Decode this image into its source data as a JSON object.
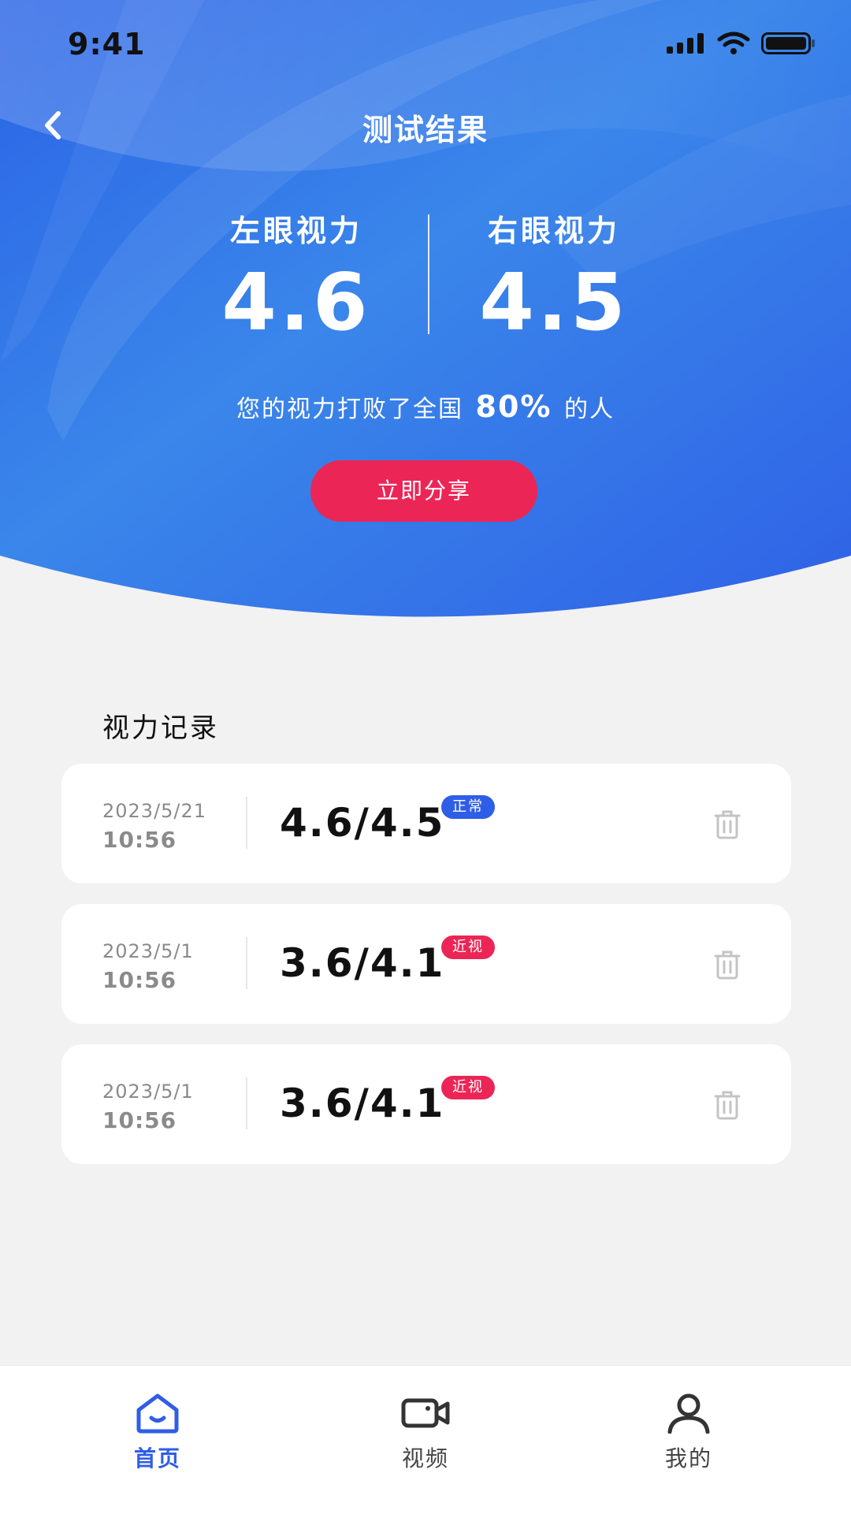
{
  "status_bar": {
    "time": "9:41"
  },
  "nav": {
    "title": "测试结果"
  },
  "result": {
    "left_label": "左眼视力",
    "left_value": "4.6",
    "right_label": "右眼视力",
    "right_value": "4.5",
    "beat_prefix": "您的视力打败了全国",
    "beat_percent": "80%",
    "beat_suffix": "的人",
    "share_label": "立即分享"
  },
  "records": {
    "title": "视力记录",
    "items": [
      {
        "date": "2023/5/21",
        "time": "10:56",
        "score": "4.6/4.5",
        "badge": "正常",
        "badge_color": "#2f5ee6"
      },
      {
        "date": "2023/5/1",
        "time": "10:56",
        "score": "3.6/4.1",
        "badge": "近视",
        "badge_color": "#eb2656"
      },
      {
        "date": "2023/5/1",
        "time": "10:56",
        "score": "3.6/4.1",
        "badge": "近视",
        "badge_color": "#eb2656"
      }
    ]
  },
  "tabbar": {
    "items": [
      {
        "label": "首页",
        "icon": "home-icon",
        "active": true
      },
      {
        "label": "视频",
        "icon": "video-camera-icon",
        "active": false
      },
      {
        "label": "我的",
        "icon": "user-icon",
        "active": false
      }
    ]
  },
  "colors": {
    "primary": "#2f5ee6",
    "accent": "#eb2656",
    "background": "#f2f2f2"
  }
}
